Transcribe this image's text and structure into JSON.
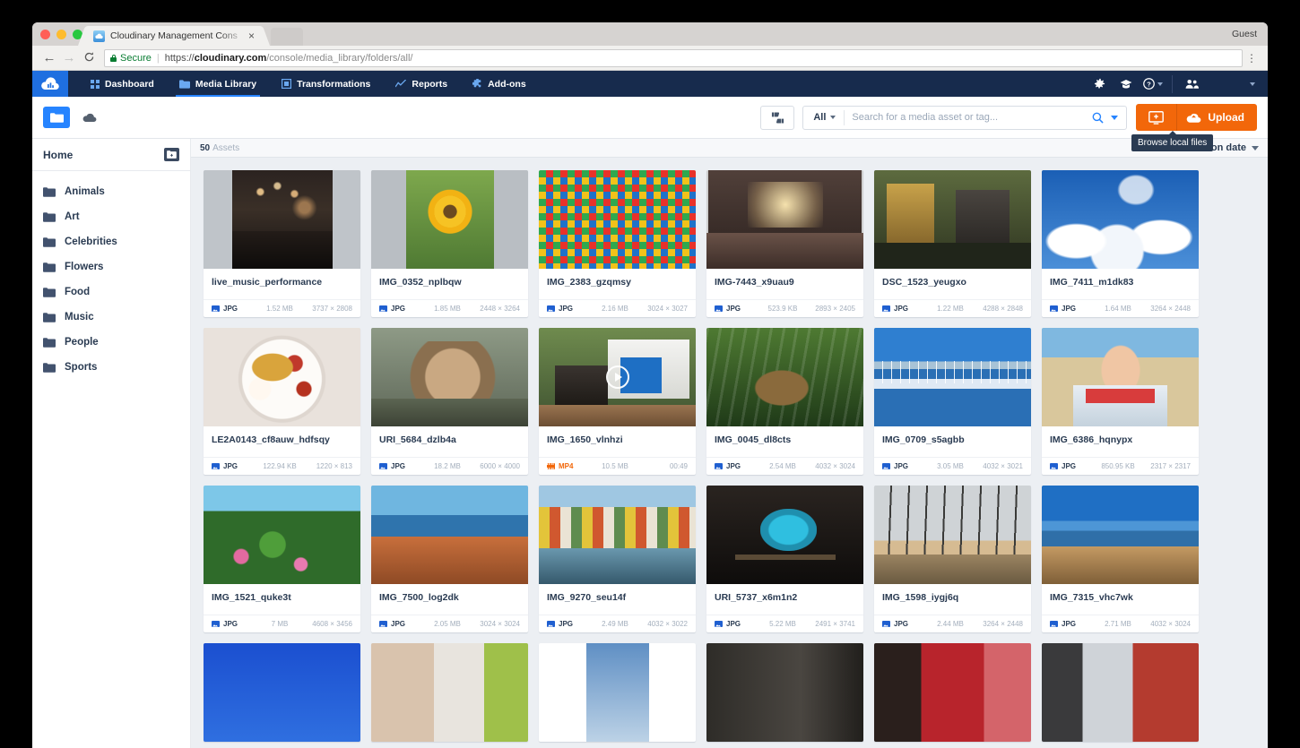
{
  "browser": {
    "tab_title": "Cloudinary Management Cons",
    "tab_close": "×",
    "guest_label": "Guest",
    "back_icon": "←",
    "forward_icon": "→",
    "reload_icon": "C",
    "menu_icon": "⋮",
    "secure_label": "Secure",
    "url_separator": "|",
    "url_scheme": "https://",
    "url_host": "cloudinary.com",
    "url_path": "/console/media_library/folders/all/"
  },
  "appnav": {
    "logo_name": "cloudinary-logo",
    "items": [
      {
        "label": "Dashboard",
        "icon": "dashboard-icon",
        "active": false
      },
      {
        "label": "Media Library",
        "icon": "media-library-icon",
        "active": true
      },
      {
        "label": "Transformations",
        "icon": "transformations-icon",
        "active": false
      },
      {
        "label": "Reports",
        "icon": "reports-icon",
        "active": false
      },
      {
        "label": "Add-ons",
        "icon": "addons-icon",
        "active": false
      }
    ],
    "right_icons": [
      "settings-gear-icon",
      "graduation-cap-icon",
      "help-question-icon",
      "users-icon"
    ]
  },
  "toolbar": {
    "folder_view_icon": "folder-icon",
    "cloud_icon": "cloud-icon",
    "moderation_icon": "thumbs-updown-icon",
    "filter_label": "All",
    "search_placeholder": "Search for a media asset or tag...",
    "search_value": "",
    "search_icon": "magnifier-icon",
    "browse_icon": "browse-local-files-icon",
    "upload_label": "Upload",
    "upload_icon": "cloud-upload-icon",
    "tooltip": "Browse local files"
  },
  "sidebar": {
    "home_label": "Home",
    "new_folder_icon": "new-folder-icon",
    "items": [
      {
        "label": "Animals"
      },
      {
        "label": "Art"
      },
      {
        "label": "Celebrities"
      },
      {
        "label": "Flowers"
      },
      {
        "label": "Food"
      },
      {
        "label": "Music"
      },
      {
        "label": "People"
      },
      {
        "label": "Sports"
      }
    ]
  },
  "content": {
    "assets_count": "50",
    "assets_word": "Assets",
    "sort_label": "Creation date"
  },
  "assets": [
    {
      "name": "live_music_performance",
      "format": "JPG",
      "size": "1.52 MB",
      "dimensions": "3737 × 2808",
      "type": "image"
    },
    {
      "name": "IMG_0352_nplbqw",
      "format": "JPG",
      "size": "1.85 MB",
      "dimensions": "2448 × 3264",
      "type": "image"
    },
    {
      "name": "IMG_2383_gzqmsy",
      "format": "JPG",
      "size": "2.16 MB",
      "dimensions": "3024 × 3027",
      "type": "image"
    },
    {
      "name": "IMG-7443_x9uau9",
      "format": "JPG",
      "size": "523.9 KB",
      "dimensions": "2893 × 2405",
      "type": "image"
    },
    {
      "name": "DSC_1523_yeugxo",
      "format": "JPG",
      "size": "1.22 MB",
      "dimensions": "4288 × 2848",
      "type": "image"
    },
    {
      "name": "IMG_7411_m1dk83",
      "format": "JPG",
      "size": "1.64 MB",
      "dimensions": "3264 × 2448",
      "type": "image"
    },
    {
      "name": "LE2A0143_cf8auw_hdfsqy",
      "format": "JPG",
      "size": "122.94 KB",
      "dimensions": "1220 × 813",
      "type": "image"
    },
    {
      "name": "URI_5684_dzlb4a",
      "format": "JPG",
      "size": "18.2 MB",
      "dimensions": "6000 × 4000",
      "type": "image"
    },
    {
      "name": "IMG_1650_vlnhzi",
      "format": "MP4",
      "size": "10.5 MB",
      "dimensions": "00:49",
      "type": "video"
    },
    {
      "name": "IMG_0045_dl8cts",
      "format": "JPG",
      "size": "2.54 MB",
      "dimensions": "4032 × 3024",
      "type": "image"
    },
    {
      "name": "IMG_0709_s5agbb",
      "format": "JPG",
      "size": "3.05 MB",
      "dimensions": "4032 × 3021",
      "type": "image"
    },
    {
      "name": "IMG_6386_hqnypx",
      "format": "JPG",
      "size": "850.95 KB",
      "dimensions": "2317 × 2317",
      "type": "image"
    },
    {
      "name": "IMG_1521_quke3t",
      "format": "JPG",
      "size": "7 MB",
      "dimensions": "4608 × 3456",
      "type": "image"
    },
    {
      "name": "IMG_7500_log2dk",
      "format": "JPG",
      "size": "2.05 MB",
      "dimensions": "3024 × 3024",
      "type": "image"
    },
    {
      "name": "IMG_9270_seu14f",
      "format": "JPG",
      "size": "2.49 MB",
      "dimensions": "4032 × 3022",
      "type": "image"
    },
    {
      "name": "URI_5737_x6m1n2",
      "format": "JPG",
      "size": "5.22 MB",
      "dimensions": "2491 × 3741",
      "type": "image"
    },
    {
      "name": "IMG_1598_iygj6q",
      "format": "JPG",
      "size": "2.44 MB",
      "dimensions": "3264 × 2448",
      "type": "image"
    },
    {
      "name": "IMG_7315_vhc7wk",
      "format": "JPG",
      "size": "2.71 MB",
      "dimensions": "4032 × 3024",
      "type": "image"
    }
  ],
  "colors": {
    "brand_navy": "#172b4d",
    "brand_blue": "#2684ff",
    "upload_orange": "#f2670a",
    "annotation_red": "#ee2a1e"
  }
}
